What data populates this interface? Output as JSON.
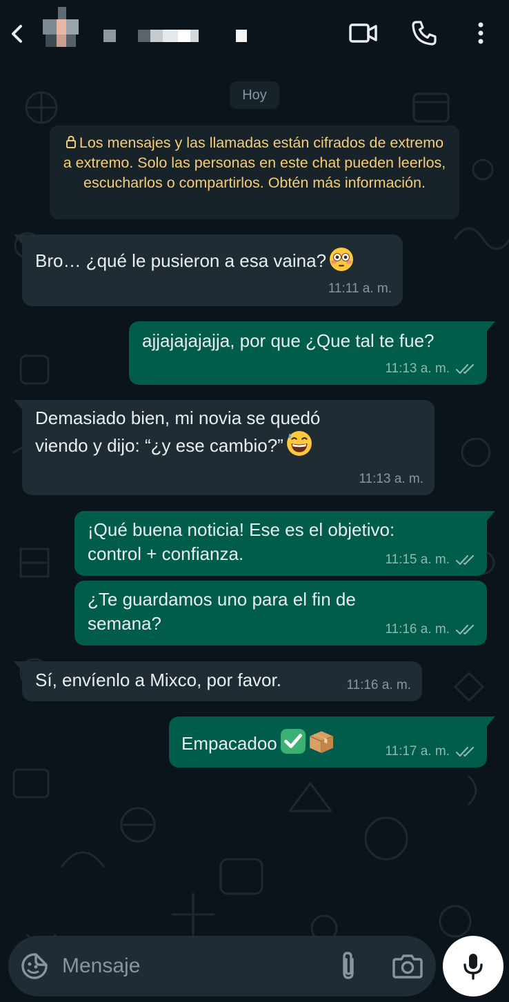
{
  "header": {
    "contact_name": "",
    "icons": {
      "back": "arrow-back-icon",
      "video": "video-call-icon",
      "call": "phone-icon",
      "menu": "more-vertical-icon"
    }
  },
  "chat": {
    "date_label": "Hoy",
    "encryption_notice": "Los mensajes y las llamadas están cifrados de extremo a extremo. Solo las personas en este chat pueden leerlos, escucharlos o compartirlos. Obtén más información.",
    "messages": [
      {
        "direction": "incoming",
        "text": "Bro… ¿qué le pusieron a esa vaina?",
        "emoji": "flushed-face",
        "time": "11:11 a. m."
      },
      {
        "direction": "outgoing",
        "text": "ajjajajajajja, por que ¿Que tal te fue?",
        "time": "11:13 a. m.",
        "status": "read"
      },
      {
        "direction": "incoming",
        "text": "Demasiado bien, mi novia se quedó\nviendo y dijo: “¿y ese cambio?”",
        "emoji": "grinning-sweat-face",
        "time": "11:13 a. m."
      },
      {
        "direction": "outgoing",
        "text": "¡Qué buena noticia! Ese es el objetivo:\ncontrol + confianza.",
        "time": "11:15 a. m.",
        "status": "read"
      },
      {
        "direction": "outgoing",
        "text": "¿Te guardamos uno para el fin de\nsemana?",
        "time": "11:16 a. m.",
        "status": "read"
      },
      {
        "direction": "incoming",
        "text": "Sí, envíenlo a Mixco, por favor.",
        "time": "11:16 a. m."
      },
      {
        "direction": "outgoing",
        "text": "Empacadoo",
        "emoji": "check-mark-button package",
        "time": "11:17 a. m.",
        "status": "read"
      }
    ]
  },
  "composer": {
    "placeholder": "Mensaje",
    "icons": {
      "emoji": "sticker-smiley-icon",
      "attach": "paperclip-icon",
      "camera": "camera-icon",
      "mic": "microphone-icon"
    }
  },
  "colors": {
    "background": "#0b141a",
    "incoming_bubble": "#202c33",
    "outgoing_bubble": "#005c4b",
    "notice_text": "#f7cd73",
    "meta_text": "#8696a0",
    "read_ticks": "#8fb9ad"
  }
}
